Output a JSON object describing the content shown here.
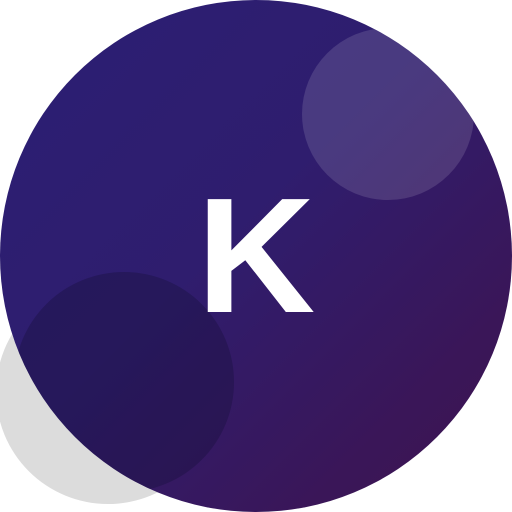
{
  "avatar": {
    "initial": "K",
    "colors": {
      "gradient_start": "#2b1f74",
      "gradient_end": "#3e1350",
      "text": "#ffffff",
      "backdrop_blob": "#dcdcdc"
    }
  }
}
